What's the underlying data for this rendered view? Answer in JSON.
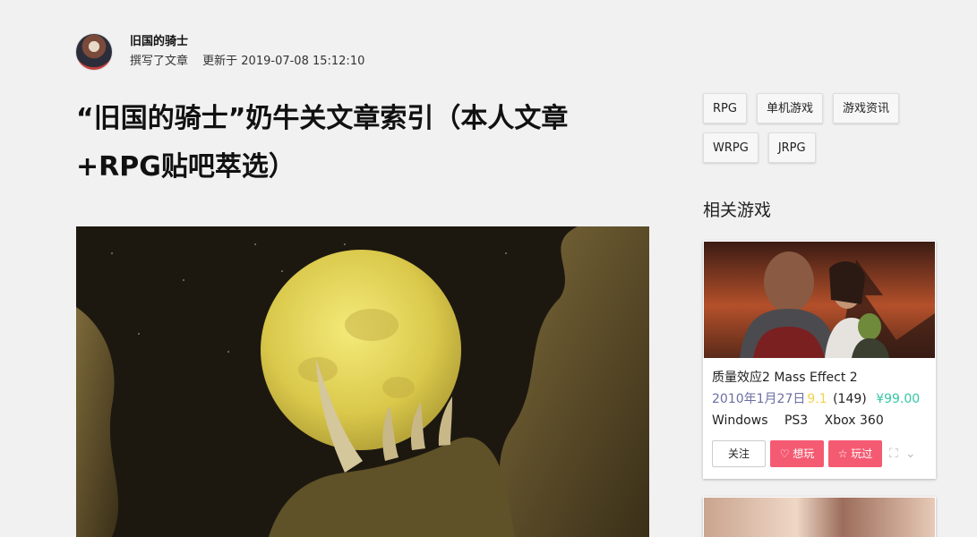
{
  "author": {
    "name": "旧国的骑士",
    "action": "撰写了文章",
    "updated": "更新于 2019-07-08 15:12:10"
  },
  "article": {
    "title": "“旧国的骑士”奶牛关文章索引（本人文章+RPG贴吧萃选）"
  },
  "tags": [
    "RPG",
    "单机游戏",
    "游戏资讯",
    "WRPG",
    "JRPG"
  ],
  "related": {
    "heading": "相关游戏",
    "game": {
      "name": "质量效应2 Mass Effect 2",
      "date": "2010年1月27日",
      "score": "9.1",
      "count": "(149)",
      "price": "¥99.00",
      "platforms": [
        "Windows",
        "PS3",
        "Xbox 360"
      ],
      "follow_label": "关注",
      "want_label": "想玩",
      "played_label": "玩过"
    }
  },
  "icons": {
    "heart": "heart-icon",
    "star": "star-icon",
    "bookmark": "bookmark-icon",
    "chevron": "chevron-down-icon"
  },
  "colors": {
    "want_button": "#f45b72",
    "price": "#35c7a4",
    "score": "#f5d24a",
    "date": "#6b6fa3"
  }
}
